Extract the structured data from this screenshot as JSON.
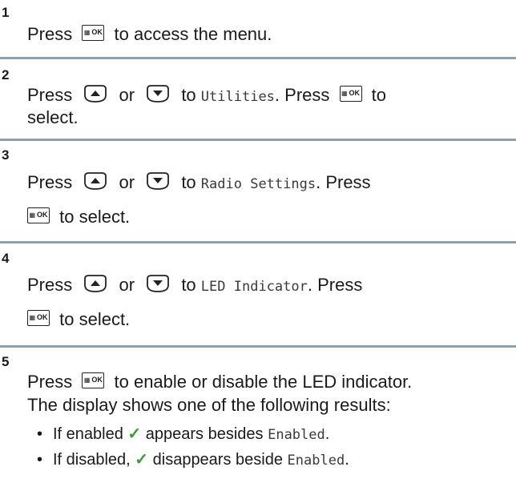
{
  "steps": [
    {
      "number": "1"
    },
    {
      "number": "2"
    },
    {
      "number": "3"
    },
    {
      "number": "4"
    },
    {
      "number": "5"
    }
  ],
  "text": {
    "press": "Press",
    "or": "or",
    "to": "to",
    "to_select": "to select.",
    "select": "select.",
    "access_menu": "to access the menu.",
    "press_period": ". Press",
    "enable_disable": "to enable or disable the LED indicator.",
    "display_shows": "The display shows one of the following results:",
    "if_enabled": "If enabled",
    "appears_besides": "appears besides",
    "if_disabled": "If disabled,",
    "disappears_beside": "disappears beside",
    "bullet": "•",
    "period": "."
  },
  "menu_items": {
    "utilities": "Utilities",
    "radio_settings": "Radio Settings",
    "led_indicator": "LED Indicator",
    "enabled": "Enabled"
  },
  "buttons": {
    "ok_label": "OK",
    "ok_grid": "▦"
  },
  "icons": {
    "ok": "menu-ok-button-icon",
    "up": "up-arrow-button-icon",
    "down": "down-arrow-button-icon",
    "check": "checkmark-icon"
  },
  "colors": {
    "rule": "#8da0ae",
    "check": "#3a9a3a"
  }
}
